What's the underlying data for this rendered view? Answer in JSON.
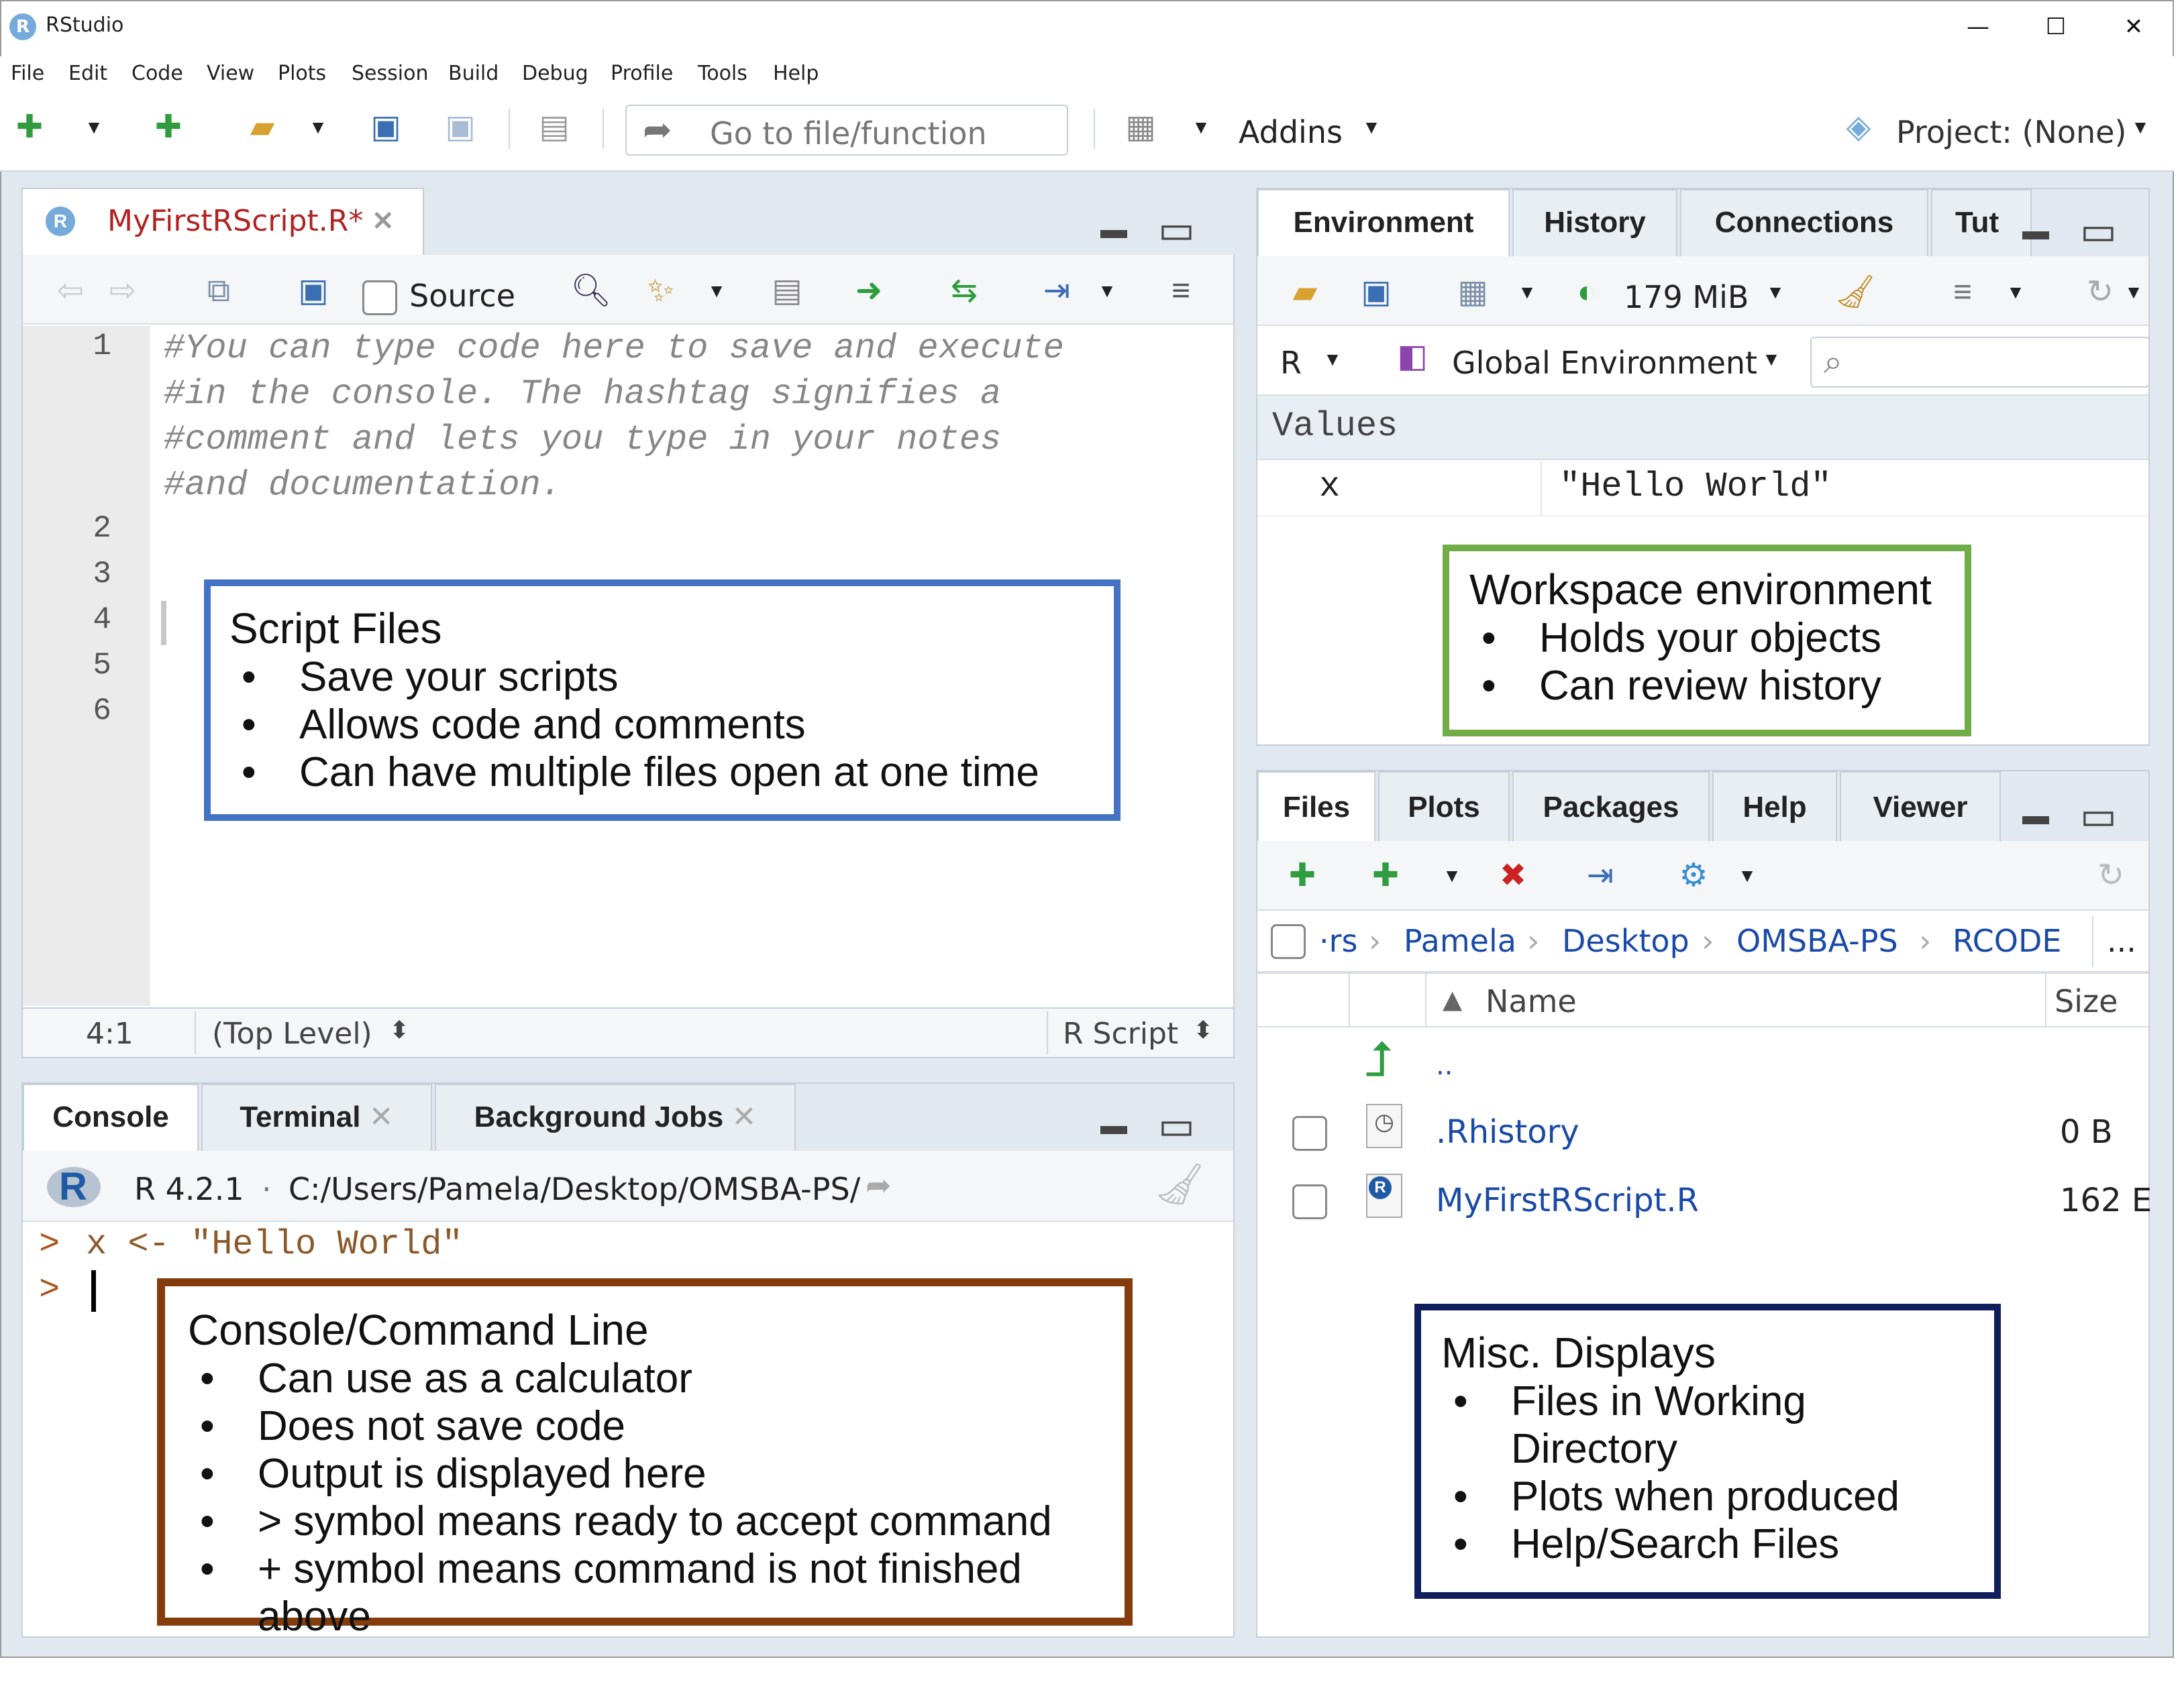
{
  "window": {
    "title": "RStudio",
    "app_icon_letter": "R",
    "minimize": "—",
    "maximize": "☐",
    "close": "✕"
  },
  "menu": [
    "File",
    "Edit",
    "Code",
    "View",
    "Plots",
    "Session",
    "Build",
    "Debug",
    "Profile",
    "Tools",
    "Help"
  ],
  "toolbar": {
    "goto_placeholder": "Go to file/function",
    "addins_label": "Addins",
    "project_label": "Project: (None)"
  },
  "source": {
    "tab_title": "MyFirstRScript.R*",
    "source_label": "Source",
    "lines": [
      {
        "n": "1",
        "text": "#You can type code here to save and execute"
      },
      {
        "n": "",
        "text": "#in the console. The hashtag signifies a"
      },
      {
        "n": "",
        "text": "#comment and lets you type in your notes"
      },
      {
        "n": "",
        "text": "#and documentation."
      },
      {
        "n": "2",
        "text": ""
      },
      {
        "n": "3",
        "text": ""
      },
      {
        "n": "4",
        "text": ""
      },
      {
        "n": "5",
        "text": ""
      },
      {
        "n": "6",
        "text": ""
      }
    ],
    "status_position": "4:1",
    "status_scope": "(Top Level)",
    "status_type": "R Script"
  },
  "console": {
    "tabs": [
      "Console",
      "Terminal",
      "Background Jobs"
    ],
    "r_version": "R 4.2.1",
    "path": "C:/Users/Pamela/Desktop/OMSBA-PS/",
    "prompt": ">",
    "line1": "x <- \"Hello World\""
  },
  "environment": {
    "tabs": [
      "Environment",
      "History",
      "Connections",
      "Tut"
    ],
    "memory": "179 MiB",
    "lang": "R",
    "scope": "Global Environment",
    "section": "Values",
    "var_name": "x",
    "var_value": "\"Hello World\""
  },
  "files": {
    "tabs": [
      "Files",
      "Plots",
      "Packages",
      "Help",
      "Viewer"
    ],
    "breadcrumb": [
      "·rs",
      "Pamela",
      "Desktop",
      "OMSBA-PS",
      "RCODE"
    ],
    "more": "...",
    "col_name": "Name",
    "col_size": "Size",
    "up_label": "..",
    "rows": [
      {
        "name": ".Rhistory",
        "size": "0 B"
      },
      {
        "name": "MyFirstRScript.R",
        "size": "162 E"
      }
    ]
  },
  "callouts": {
    "script": {
      "title": "Script Files",
      "bullets": [
        "Save your scripts",
        "Allows code and comments",
        "Can have multiple files open at one time"
      ],
      "color": "#4472c4"
    },
    "workspace": {
      "title": "Workspace environment",
      "bullets": [
        "Holds your objects",
        "Can review history"
      ],
      "color": "#70ad47"
    },
    "console": {
      "title": "Console/Command Line",
      "bullets": [
        "Can use as a calculator",
        "Does not save code",
        "Output is displayed here",
        "> symbol means ready to accept command",
        "+ symbol means command is not finished above"
      ],
      "color": "#843c0c"
    },
    "misc": {
      "title": "Misc. Displays",
      "bullets": [
        "Files in Working Directory",
        "Plots when produced",
        "Help/Search Files"
      ],
      "color": "#0e1f5c"
    }
  }
}
